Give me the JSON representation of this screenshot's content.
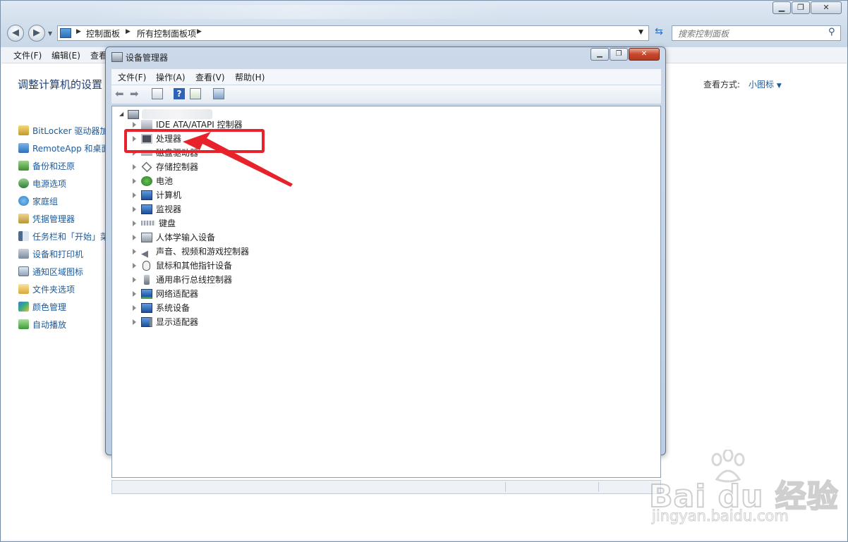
{
  "outer": {
    "breadcrumb": [
      "控制面板",
      "所有控制面板项"
    ],
    "search_placeholder": "搜索控制面板",
    "menu": [
      "文件(F)",
      "编辑(E)",
      "查看"
    ],
    "page_title": "调整计算机的设置",
    "view_by_label": "查看方式:",
    "view_by_value": "小图标",
    "items": [
      "BitLocker 驱动器加",
      "RemoteApp 和桌面",
      "备份和还原",
      "电源选项",
      "家庭组",
      "凭据管理器",
      "任务栏和「开始」菜",
      "设备和打印机",
      "通知区域图标",
      "文件夹选项",
      "颜色管理",
      "自动播放"
    ]
  },
  "device_manager": {
    "title": "设备管理器",
    "menu": [
      "文件(F)",
      "操作(A)",
      "查看(V)",
      "帮助(H)"
    ],
    "categories": [
      "IDE ATA/ATAPI 控制器",
      "处理器",
      "磁盘驱动器",
      "存储控制器",
      "电池",
      "计算机",
      "监视器",
      "键盘",
      "人体学输入设备",
      "声音、视频和游戏控制器",
      "鼠标和其他指针设备",
      "通用串行总线控制器",
      "网络适配器",
      "系统设备",
      "显示适配器"
    ]
  },
  "watermark": {
    "brand": "Bai du 经验",
    "url": "jingyan.baidu.com"
  },
  "colors": {
    "link": "#1e5a99",
    "highlight": "#e8222b"
  }
}
